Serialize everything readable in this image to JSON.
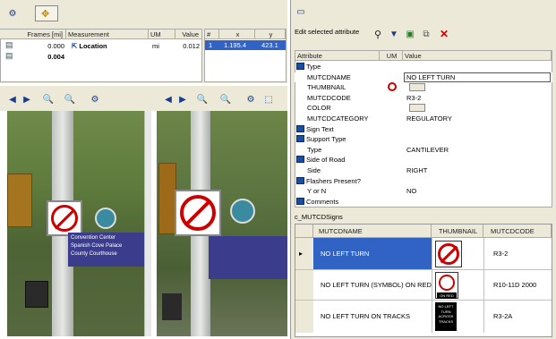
{
  "left_panel": {
    "table_headers": [
      "Frames [mi]",
      "Measurement",
      "UM",
      "Value"
    ],
    "rows": [
      {
        "frames": "0.000",
        "measurement": "Location",
        "um": "mi",
        "value": "0.012"
      },
      {
        "frames": "0.004",
        "measurement": "",
        "um": "",
        "value": ""
      }
    ],
    "small_headers": [
      "#",
      "x",
      "y"
    ],
    "small_row": {
      "n": "1",
      "x": "1.195.4",
      "y": "423.1"
    }
  },
  "attr_panel": {
    "title": "Edit selected attribute",
    "col_attribute": "Attribute",
    "col_um": "UM",
    "col_value": "Value",
    "rows": [
      {
        "label": "Type",
        "value": "",
        "group": true
      },
      {
        "label": "MUTCDNAME",
        "value": "NO LEFT TURN",
        "group": false
      },
      {
        "label": "THUMBNAIL",
        "value": "",
        "group": false
      },
      {
        "label": "MUTCDCODE",
        "value": "R3-2",
        "group": false
      },
      {
        "label": "COLOR",
        "value": "",
        "group": false
      },
      {
        "label": "MUTCDCATEGORY",
        "value": "REGULATORY",
        "group": false
      },
      {
        "label": "Sign Text",
        "value": "",
        "group": true
      },
      {
        "label": "Support Type",
        "value": "",
        "group": true
      },
      {
        "label": "Type",
        "value": "CANTILEVER",
        "group": false
      },
      {
        "label": "Side of Road",
        "value": "",
        "group": true
      },
      {
        "label": "Side",
        "value": "RIGHT",
        "group": false
      },
      {
        "label": "Flashers Present?",
        "value": "",
        "group": true
      },
      {
        "label": "Y or N",
        "value": "NO",
        "group": false
      },
      {
        "label": "Comments",
        "value": "",
        "group": true
      }
    ]
  },
  "signs_table": {
    "title": "c_MUTCDSigns",
    "headers": [
      "MUTCDNAME",
      "THUMBNAIL",
      "MUTCDCODE"
    ],
    "rows": [
      {
        "name": "NO LEFT TURN",
        "code": "R3-2",
        "thumb_text": ""
      },
      {
        "name": "NO LEFT TURN (SYMBOL) ON RED",
        "code": "R10-11D 2000",
        "thumb_text": "ON RED"
      },
      {
        "name": "NO LEFT TURN ON TRACKS",
        "code": "R3-2A",
        "thumb_text": "NO LEFT TURN ACROSS TRACKS"
      }
    ]
  },
  "photo_signs": {
    "left_text": [
      "Convention Center",
      "Spanish Cove Palace",
      "County Courthouse"
    ]
  },
  "colors": {
    "selected_row": "#3163c5",
    "accent_red": "#cc0000"
  }
}
